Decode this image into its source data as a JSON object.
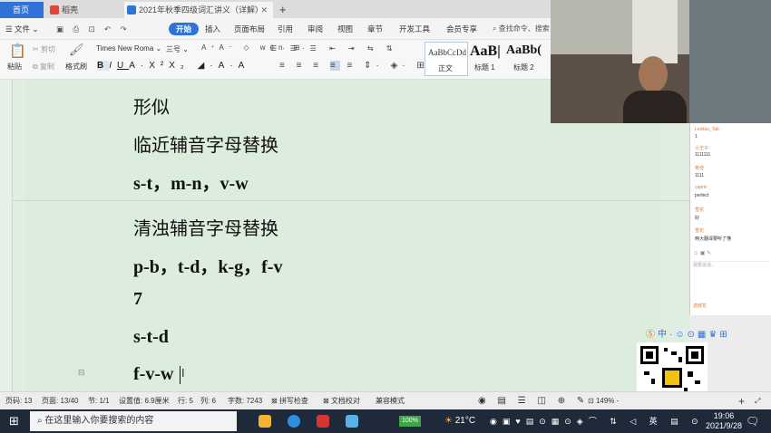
{
  "tabs": [
    {
      "label": "首页"
    },
    {
      "label": "稻壳"
    },
    {
      "label": "2021年秋季四级词汇讲义（详解）",
      "close": "✕"
    }
  ],
  "menu": {
    "file": "文件",
    "items": [
      "开始",
      "插入",
      "页面布局",
      "引用",
      "审阅",
      "视图",
      "章节",
      "开发工具",
      "会员专享"
    ],
    "search": "查找命令、搜索"
  },
  "ribbon": {
    "paste": "粘贴",
    "cut": "剪切",
    "copy": "复制",
    "format_painter": "格式刷",
    "font_name": "Times New Roma",
    "font_size": "三号",
    "styles": [
      {
        "preview": "AaBbCcDd",
        "name": "正文"
      },
      {
        "preview": "AaB|",
        "name": "标题 1"
      },
      {
        "preview": "AaBb(",
        "name": "标题 2"
      }
    ]
  },
  "document": {
    "lines": [
      {
        "text": "形似",
        "bold": false
      },
      {
        "text": "临近辅音字母替换",
        "bold": false
      },
      {
        "text": "s-t，m-n，v-w",
        "bold": true
      },
      {
        "text": "清浊辅音字母替换",
        "bold": false
      },
      {
        "text": "p-b，t-d，k-g，f-v",
        "bold": true
      },
      {
        "text": "7",
        "bold": true
      },
      {
        "text": "s-t-d",
        "bold": true
      },
      {
        "text": "f-v-w",
        "bold": true
      }
    ]
  },
  "chat": {
    "messages": [
      {
        "name": "Lesliao_Tab",
        "text": "1"
      },
      {
        "name": "小王子",
        "text": "1111111"
      },
      {
        "name": "蒋佳",
        "text": "1111"
      },
      {
        "name": "capric",
        "text": "perfect"
      },
      {
        "name": "雪花",
        "text": "好"
      },
      {
        "name": "雪花",
        "text": "两大翻译要听了懂"
      }
    ],
    "input_placeholder": "我要说话...",
    "footer": "送鲜花"
  },
  "statusbar": {
    "page_code": "页码: 13",
    "page_count": "页面: 13/40",
    "section": "节: 1/1",
    "setting": "设置值: 6.9厘米",
    "row": "行: 5",
    "col": "列: 6",
    "word_count": "字数: 7243",
    "spellcheck": "拼写检查",
    "doc_check": "文档校对",
    "compat": "兼容模式",
    "zoom": "149%"
  },
  "taskbar": {
    "search_placeholder": "在这里输入你要搜索的内容",
    "battery": "100%",
    "weather": "21°C",
    "time": "19:06",
    "date": "2021/9/28"
  },
  "colors": {
    "accent": "#2f72d8",
    "doc_bg": "#dcecdd",
    "taskbar": "#1e2a3a"
  }
}
